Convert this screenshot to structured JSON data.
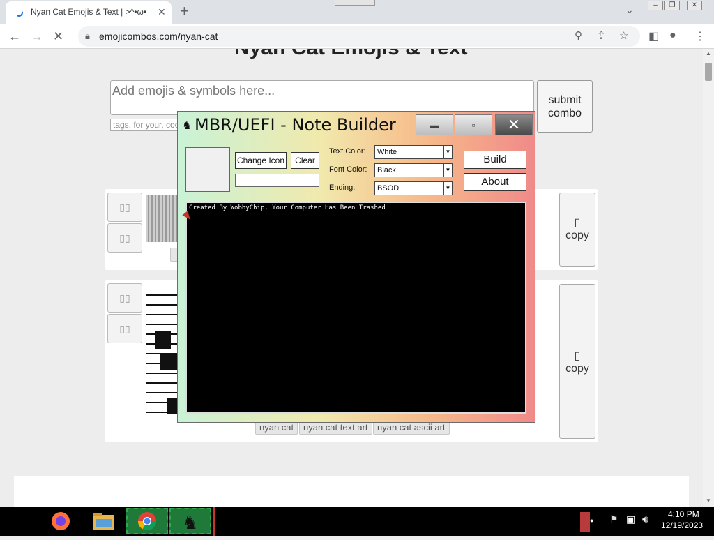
{
  "browser": {
    "tab_title": "Nyan Cat Emojis & Text | >^•ω•",
    "tab_close": "✕",
    "new_tab": "+",
    "url": "emojicombos.com/nyan-cat",
    "window_controls": [
      "‒",
      "❐",
      "✕"
    ]
  },
  "page": {
    "heading": "Nyan Cat Emojis & Text",
    "emoji_input_placeholder": "Add emojis & symbols here...",
    "tags_input_placeholder": "tags, for your, coo",
    "submit_label": "submit combo",
    "copy_label": "copy",
    "copy_glyph": "▯",
    "sq_glyph": "▯▯",
    "tags": [
      "nyan cat",
      "nyan cat text art",
      "nyan cat ascii art"
    ]
  },
  "note_builder": {
    "title": "MBR/UEFI - Note Builder",
    "title_icon": "♞",
    "change_icon_label": "Change Icon",
    "clear_label": "Clear",
    "text_color_label": "Text Color:",
    "text_color_value": "White",
    "font_color_label": "Font Color:",
    "font_color_value": "Black",
    "ending_label": "Ending:",
    "ending_value": "BSOD",
    "build_label": "Build",
    "about_label": "About",
    "note_text": "Created By WobbyChip. Your Computer Has Been Trashed",
    "min_glyph": "▬",
    "max_glyph": "▫",
    "close_glyph": "✕"
  },
  "taskbar": {
    "time": "4:10 PM",
    "date": "12/19/2023"
  },
  "colors": {
    "taskbar": "#000000",
    "accent_green": "#2fa84f",
    "note_bg": "#000000"
  }
}
